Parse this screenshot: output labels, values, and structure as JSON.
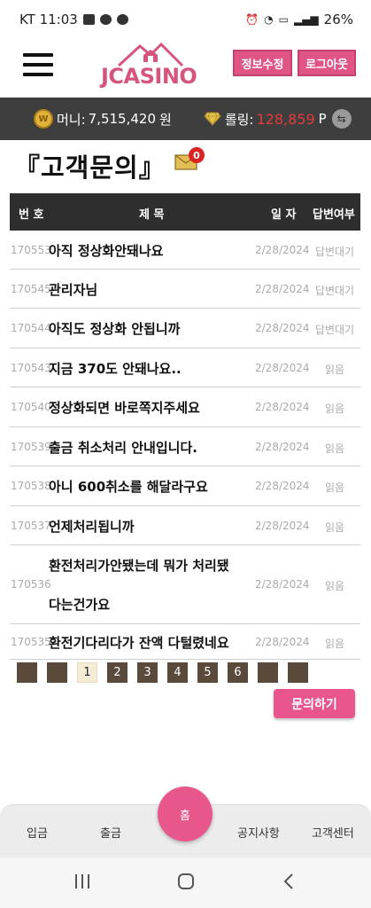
{
  "statusbar": {
    "carrier_time": "KT 11:03",
    "battery": "26%"
  },
  "header": {
    "logo_text": "JCASINO",
    "edit_button": "정보수정",
    "logout_button": "로그아웃"
  },
  "balance": {
    "coin_symbol": "W",
    "money_label": "머니:",
    "money_value": "7,515,420",
    "money_unit": "원",
    "rolling_label": "롤링:",
    "rolling_value": "128,859",
    "rolling_unit": "P",
    "swap_symbol": "⇆",
    "rolling_color": "#e23b3b"
  },
  "page": {
    "title": "『고객문의』",
    "unread_count": "0"
  },
  "table": {
    "headers": {
      "no": "번 호",
      "title": "제 목",
      "date": "일 자",
      "status": "답변여부"
    },
    "rows": [
      {
        "no": "170553",
        "title": "아직 정상화안돼나요",
        "date": "2/28/2024",
        "status": "답변대기"
      },
      {
        "no": "170545",
        "title": "관리자님",
        "date": "2/28/2024",
        "status": "답변대기"
      },
      {
        "no": "170544",
        "title": "아직도 정상화 안됩니까",
        "date": "2/28/2024",
        "status": "답변대기"
      },
      {
        "no": "170543",
        "title": "지금 370도 안돼나요..",
        "date": "2/28/2024",
        "status": "읽음"
      },
      {
        "no": "170540",
        "title": "정상화되면 바로쪽지주세요",
        "date": "2/28/2024",
        "status": "읽음"
      },
      {
        "no": "170539",
        "title": "출금 취소처리 안내입니다.",
        "date": "2/28/2024",
        "status": "읽음"
      },
      {
        "no": "170538",
        "title": "아니 600취소를 해달라구요",
        "date": "2/28/2024",
        "status": "읽음"
      },
      {
        "no": "170537",
        "title": "언제처리됩니까",
        "date": "2/28/2024",
        "status": "읽음"
      },
      {
        "no": "170536",
        "title_line1": "환전처리가안됐는데 뭐가 처리됐",
        "title_line2": "다는건가요",
        "date": "2/28/2024",
        "status": "읽음"
      },
      {
        "no": "170535",
        "title": "환전기다리다가 잔액 다털렸네요",
        "date": "2/28/2024",
        "status": "읽음"
      }
    ]
  },
  "pagination": {
    "pages": [
      "1",
      "2",
      "3",
      "4",
      "5",
      "6"
    ],
    "current": "1"
  },
  "inquire_button": "문의하기",
  "bottom_nav": {
    "deposit": "입금",
    "withdraw": "출금",
    "home": "홈",
    "notice": "공지사항",
    "support": "고객센터"
  },
  "colors": {
    "accent": "#e9568d",
    "header_bar": "#3e3e3e",
    "pager_dark": "#5a4a3c"
  }
}
